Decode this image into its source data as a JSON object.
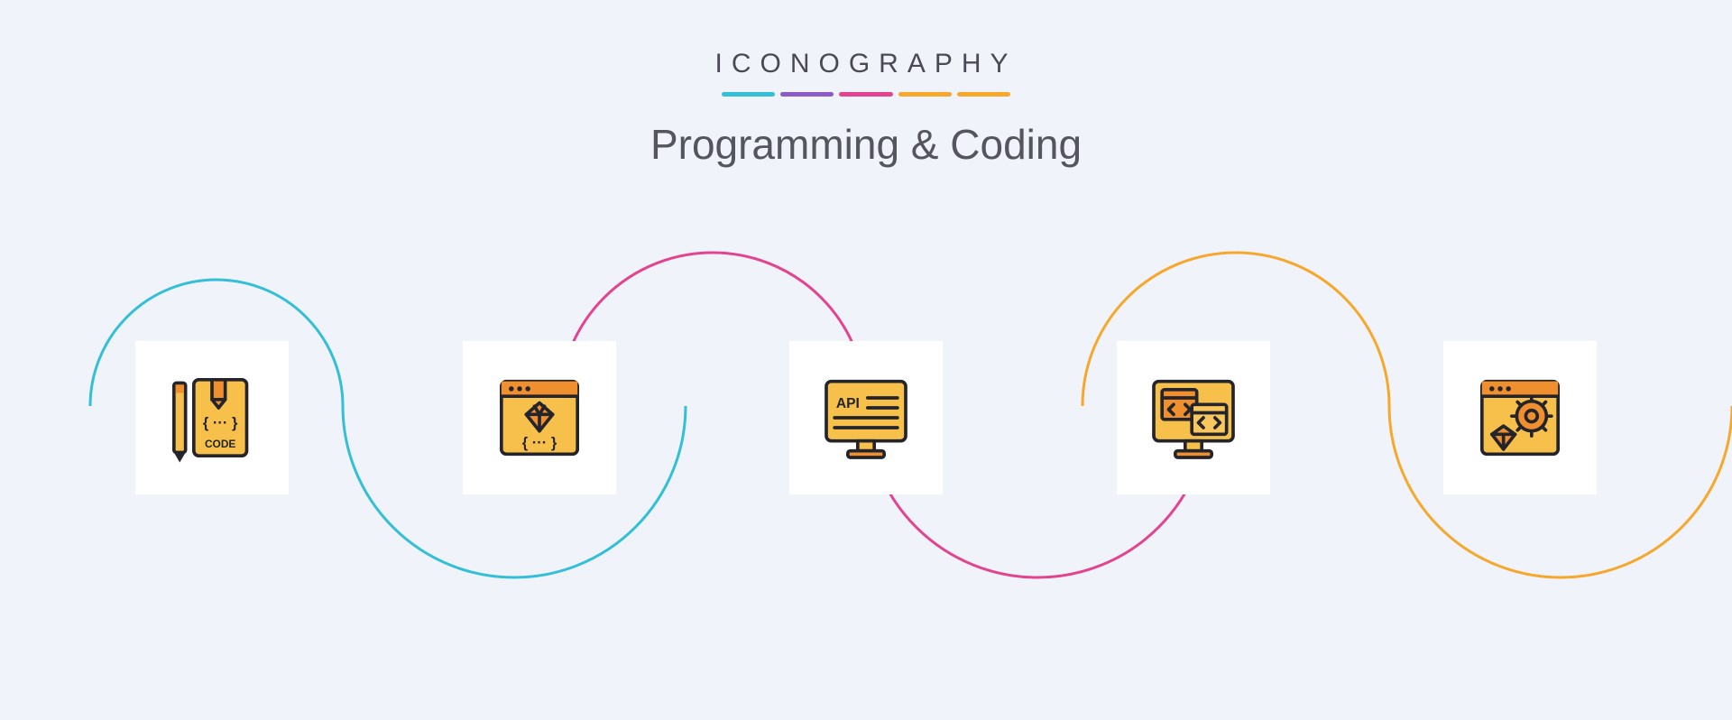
{
  "header": {
    "brand": "ICONOGRAPHY",
    "title": "Programming & Coding"
  },
  "underline_colors": [
    "#33bfd8",
    "#8d5bc9",
    "#e3448f",
    "#f6a82d",
    "#f6a82d"
  ],
  "icons": [
    {
      "name": "code-book-pencil-icon",
      "glyphs": {
        "code_label": "CODE",
        "braces": "{ ··· }"
      }
    },
    {
      "name": "browser-diamond-code-icon",
      "glyphs": {
        "braces": "{ ··· }"
      }
    },
    {
      "name": "api-monitor-icon",
      "glyphs": {
        "api_label": "API"
      }
    },
    {
      "name": "monitor-code-windows-icon",
      "glyphs": {
        "code_tags": "< >"
      }
    },
    {
      "name": "browser-diamond-gear-icon",
      "glyphs": {}
    }
  ],
  "wave_colors": [
    "#33bfd8",
    "#e3448f",
    "#f6a82d"
  ]
}
